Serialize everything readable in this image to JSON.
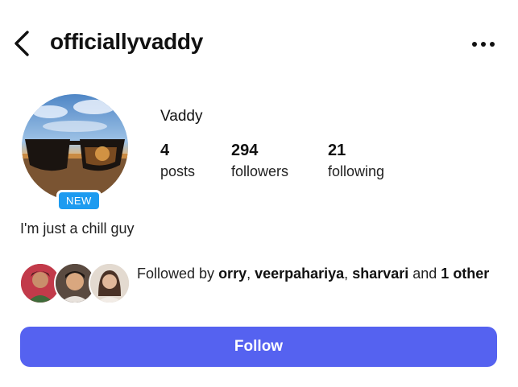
{
  "header": {
    "username": "officiallyvaddy",
    "back_icon": "chevron-left-icon",
    "more_icon": "more-horizontal-icon"
  },
  "profile": {
    "display_name": "Vaddy",
    "new_badge": "NEW",
    "bio": "I'm just a chill guy",
    "stats": [
      {
        "value": "4",
        "label": "posts"
      },
      {
        "value": "294",
        "label": "followers"
      },
      {
        "value": "21",
        "label": "following"
      }
    ]
  },
  "mutuals": {
    "prefix": "Followed by ",
    "names": [
      "orry",
      "veerpahariya",
      "sharvari"
    ],
    "sep1": ", ",
    "sep2": ", ",
    "connector": " and ",
    "other_count": "1",
    "other_word": " other"
  },
  "actions": {
    "follow_label": "Follow"
  },
  "colors": {
    "accent": "#5562f0",
    "badge": "#1d9bf0"
  }
}
